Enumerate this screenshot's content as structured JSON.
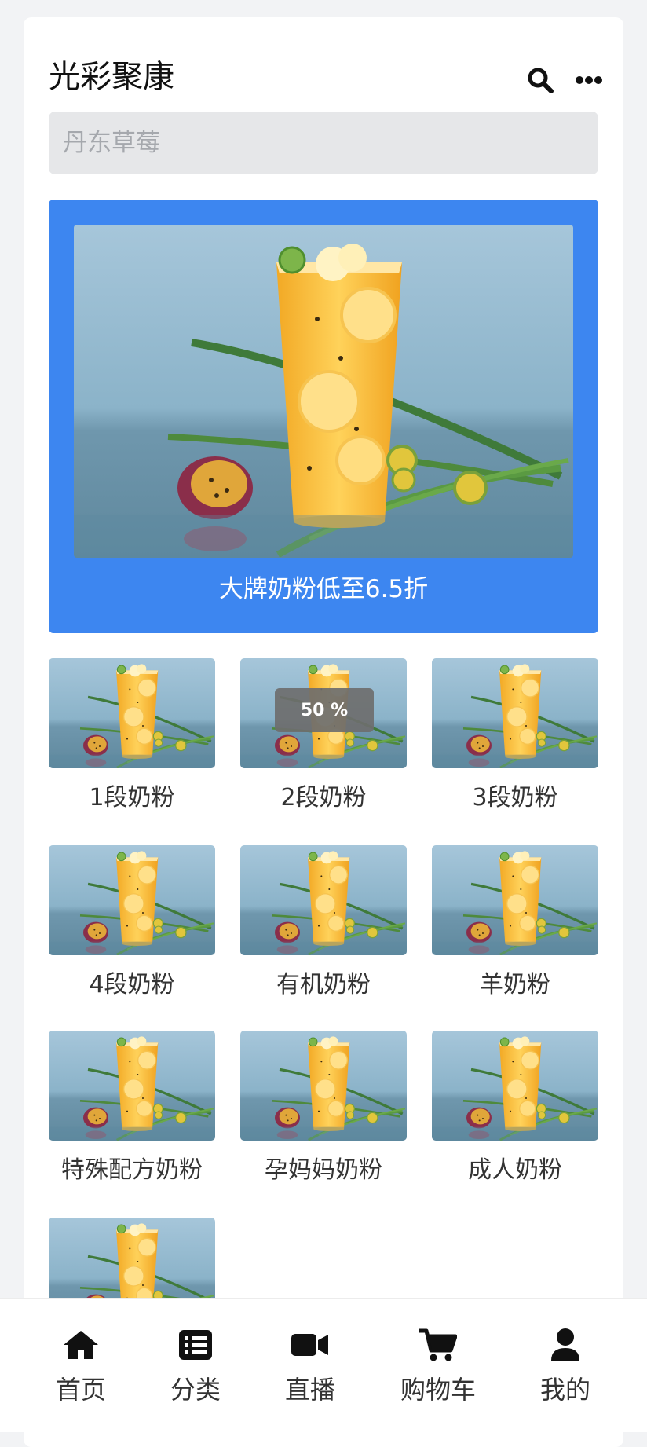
{
  "header": {
    "title": "光彩聚康",
    "search_icon": "search-icon",
    "more_icon": "more-dots-icon"
  },
  "search": {
    "placeholder": "丹东草莓"
  },
  "banner": {
    "caption": "大牌奶粉低至6.5折",
    "background_color": "#3d86f0"
  },
  "categories": [
    {
      "label": "1段奶粉"
    },
    {
      "label": "2段奶粉"
    },
    {
      "label": "3段奶粉"
    },
    {
      "label": "4段奶粉"
    },
    {
      "label": "有机奶粉"
    },
    {
      "label": "羊奶粉"
    },
    {
      "label": "特殊配方奶粉"
    },
    {
      "label": "孕妈妈奶粉"
    },
    {
      "label": "成人奶粉"
    },
    {
      "label": ""
    }
  ],
  "loading_toast": {
    "text": "50 %",
    "progress_percent": 50
  },
  "bottom_nav": [
    {
      "label": "首页",
      "icon": "home-icon"
    },
    {
      "label": "分类",
      "icon": "list-icon"
    },
    {
      "label": "直播",
      "icon": "video-camera-icon"
    },
    {
      "label": "购物车",
      "icon": "cart-icon"
    },
    {
      "label": "我的",
      "icon": "user-icon"
    }
  ]
}
